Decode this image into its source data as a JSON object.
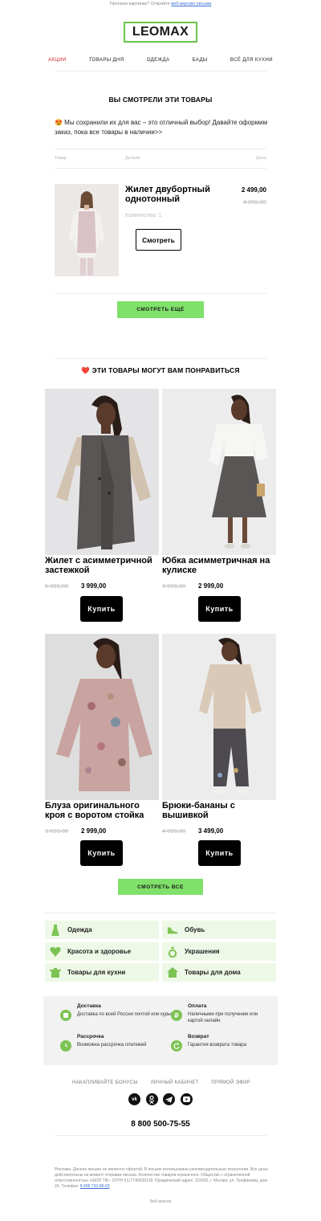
{
  "preheader": {
    "text": "Пропали картинки? Откройте",
    "link": "веб-версию письма"
  },
  "logo": {
    "text": "LEOMAX",
    "color": "#6ac448"
  },
  "nav": [
    "АКЦИИ",
    "ТОВАРЫ ДНЯ",
    "ОДЕЖДА",
    "БАДЫ",
    "ВСЁ ДЛЯ КУХНИ"
  ],
  "viewed": {
    "heading": "ВЫ СМОТРЕЛИ ЭТИ ТОВАРЫ",
    "intro": "😍 Мы сохранили их для вас – это отличный выбор! Давайте оформим заказ, пока все товары в наличии>>",
    "columns": {
      "product": "Товар",
      "details": "Детали",
      "price": "Цена"
    },
    "item": {
      "title": "Жилет двубортный однотонный",
      "price": "2 499,00",
      "old_price": "4 299,00",
      "qty": "Количество: 1",
      "button": "Смотреть"
    },
    "more_button": "СМОТРЕТЬ ЕЩЁ"
  },
  "recommend": {
    "heading": "❤️ ЭТИ ТОВАРЫ МОГУТ ВАМ ПОНРАВИТЬСЯ",
    "items": [
      {
        "title": "Жилет с асимметричной застежкой",
        "old_price": "5 399,00",
        "price": "3 999,00",
        "button": "Купить"
      },
      {
        "title": "Юбка асимметричная на кулиске",
        "old_price": "3 599,00",
        "price": "2 999,00",
        "button": "Купить"
      },
      {
        "title": "Блуза оригинального кроя с воротом стойка",
        "old_price": "3 599,00",
        "price": "2 999,00",
        "button": "Купить"
      },
      {
        "title": "Брюки-бананы с вышивкой",
        "old_price": "4 599,00",
        "price": "3 499,00",
        "button": "Купить"
      }
    ],
    "all_button": "СМОТРЕТЬ ВСЕ"
  },
  "categories": [
    {
      "label": "Одежда",
      "icon": "dress-icon"
    },
    {
      "label": "Обувь",
      "icon": "shoe-icon"
    },
    {
      "label": "Красота и здоровье",
      "icon": "heart-icon"
    },
    {
      "label": "Украшения",
      "icon": "ring-icon"
    },
    {
      "label": "Товары для кухни",
      "icon": "pot-icon"
    },
    {
      "label": "Товары для дома",
      "icon": "house-icon"
    }
  ],
  "services": [
    {
      "title": "Доставка",
      "text": "Доставка по всей России почтой или курьером",
      "icon": "box-icon"
    },
    {
      "title": "Оплата",
      "text": "Наличными при получении или картой онлайн",
      "icon": "ruble-icon"
    },
    {
      "title": "Рассрочка",
      "text": "Возможна рассрочка платежей",
      "icon": "clock-icon"
    },
    {
      "title": "Возврат",
      "text": "Гарантия возврата товара",
      "icon": "return-icon"
    }
  ],
  "footer": {
    "links": [
      "НАКАПЛИВАЙТЕ БОНУСЫ",
      "ЛИЧНЫЙ КАБИНЕТ",
      "ПРЯМОЙ ЭФИР"
    ],
    "social": [
      {
        "label": "vk",
        "icon": "vk-icon"
      },
      {
        "label": "ok",
        "icon": "odnoklassniki-icon"
      },
      {
        "label": "tg",
        "icon": "telegram-icon"
      },
      {
        "label": "yt",
        "icon": "youtube-icon"
      }
    ],
    "phone": "8 800 500-75-55",
    "legal": "Реклама. Данное письмо не является офертой. В письме использованы рекомендательные технологии. Все цены действительны на момент отправки письма. Количество товаров ограничено. Общество с ограниченной ответственностью «ШОП ТВ». ОГРН 5117746636128. Юридический адрес: 115432, г. Москва, ул. Трофимова, дом 24. Телефон:",
    "legal_phone": "8 495 733-96-03",
    "web_version": "Веб-версия"
  },
  "colors": {
    "accent_green": "#7fe06a",
    "category_bg": "#eef8e6",
    "sale_red": "#d32121"
  }
}
